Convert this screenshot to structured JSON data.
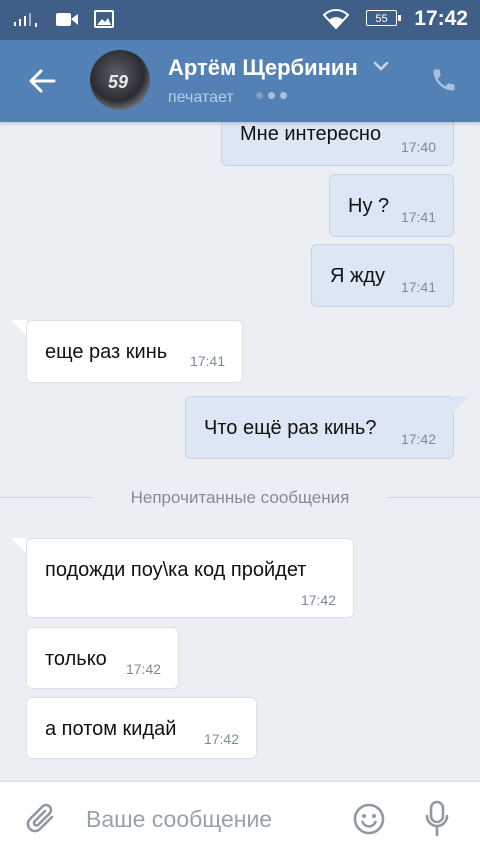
{
  "status_bar": {
    "signal": " ııl,",
    "battery": "55",
    "time": "17:42"
  },
  "header": {
    "contact_name": "Артём Щербинин",
    "status": "печатает",
    "avatar_number": "59"
  },
  "messages": [
    {
      "direction": "out",
      "text": "Мне интересно",
      "time": "17:40"
    },
    {
      "direction": "out",
      "text": "Ну ?",
      "time": "17:41"
    },
    {
      "direction": "out",
      "text": "Я жду",
      "time": "17:41"
    },
    {
      "direction": "in",
      "text": "еще раз кинь",
      "time": "17:41"
    },
    {
      "direction": "out",
      "text": "Что ещё раз кинь?",
      "time": "17:42"
    },
    {
      "direction": "in",
      "text": "подожди поу\\ка код пройдет",
      "time": "17:42"
    },
    {
      "direction": "in",
      "text": "только",
      "time": "17:42"
    },
    {
      "direction": "in",
      "text": "а потом кидай",
      "time": "17:42"
    }
  ],
  "unread_divider": "Непрочитанные сообщения",
  "input": {
    "placeholder": "Ваше сообщение"
  },
  "icons": [
    "signal-icon",
    "video-icon",
    "image-icon",
    "wifi-icon",
    "battery-icon",
    "back-arrow-icon",
    "chevron-down-icon",
    "phone-icon",
    "paperclip-icon",
    "emoji-icon",
    "microphone-icon"
  ],
  "colors": {
    "header": "#5380b5",
    "status_bar": "#3f5f88",
    "background": "#ebeef2",
    "outgoing_bubble": "#dce6f4",
    "incoming_bubble": "#ffffff"
  }
}
